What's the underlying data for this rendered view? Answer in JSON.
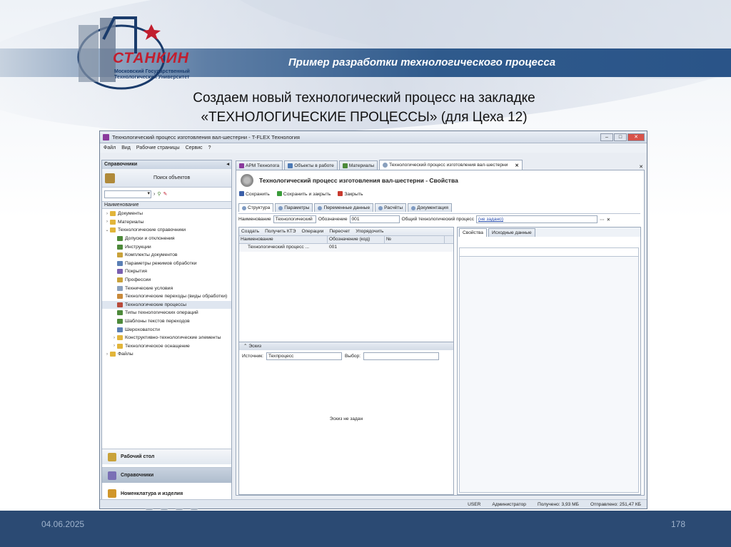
{
  "slide": {
    "title": "Пример разработки технологического процесса",
    "heading_line1": "Создаем новый технологический процесс на закладке",
    "heading_line2": "«ТЕХНОЛОГИЧЕСКИЕ ПРОЦЕССЫ» (для Цеха 12)",
    "date": "04.06.2025",
    "page": "178",
    "logo_name": "СТАНКИН",
    "logo_sub": "Московский Государственный Технологический Университет"
  },
  "window": {
    "title": "Технологический процесс изготовления вал-шестерни - T-FLEX Технология",
    "menu": [
      "Файл",
      "Вид",
      "Рабочие страницы",
      "Сервис",
      "?"
    ]
  },
  "left_panel": {
    "header": "Справочники",
    "search_label": "Поиск объектов",
    "column_header": "Наименование",
    "tree": [
      {
        "label": "Документы",
        "level": 0,
        "arrow": "›",
        "folder": true
      },
      {
        "label": "Материалы",
        "level": 0,
        "arrow": "›",
        "folder": true
      },
      {
        "label": "Технологические справочники",
        "level": 0,
        "arrow": "⌄",
        "folder": true
      },
      {
        "label": "Допуски и отклонения",
        "level": 1,
        "color": "#4d8a3a"
      },
      {
        "label": "Инструкции",
        "level": 1,
        "color": "#4d8a3a"
      },
      {
        "label": "Комплекты документов",
        "level": 1,
        "color": "#c9a23a"
      },
      {
        "label": "Параметры режимов обработки",
        "level": 1,
        "color": "#5a7fb5"
      },
      {
        "label": "Покрытия",
        "level": 1,
        "color": "#7a5fb0"
      },
      {
        "label": "Профессии",
        "level": 1,
        "color": "#c9a23a"
      },
      {
        "label": "Технические условия",
        "level": 1,
        "color": "#8aa0bd"
      },
      {
        "label": "Технологические переходы (виды обработки)",
        "level": 1,
        "color": "#c98a3a"
      },
      {
        "label": "Технологические процессы",
        "level": 1,
        "color": "#b84a3a",
        "selected": true
      },
      {
        "label": "Типы технологических операций",
        "level": 1,
        "color": "#4d8a3a"
      },
      {
        "label": "Шаблоны текстов переходов",
        "level": 1,
        "color": "#4d8a3a"
      },
      {
        "label": "Шероховатости",
        "level": 1,
        "color": "#5a7fb5"
      },
      {
        "label": "Конструктивно-технологические элементы",
        "level": 1,
        "arrow": "›",
        "folder": true
      },
      {
        "label": "Технологическое оснащение",
        "level": 1,
        "arrow": "›",
        "folder": true
      },
      {
        "label": "Файлы",
        "level": 0,
        "arrow": "›",
        "folder": true
      }
    ],
    "nav_buttons": [
      "Рабочий стол",
      "Справочники",
      "Номенклатура и изделия"
    ]
  },
  "tabs": [
    {
      "label": "АРМ Технолога",
      "color": "#8a3a9c"
    },
    {
      "label": "Объекты в работе",
      "color": "#4d7ab5"
    },
    {
      "label": "Материалы",
      "color": "#4d8a3a"
    },
    {
      "label": "Технологический процесс изготовления вал-шестерни",
      "color": "#8aa0bd",
      "active": true
    }
  ],
  "document": {
    "header": "Технологический процесс изготовления вал-шестерни - Свойства",
    "toolbar": [
      "Сохранить",
      "Сохранить и закрыть",
      "Закрыть"
    ],
    "subtabs": [
      "Структура",
      "Параметры",
      "Переменные данные",
      "Расчёты",
      "Документация"
    ],
    "fields": {
      "name_label": "Наименование",
      "name_value": "Технологический",
      "designation_label": "Обозначение",
      "designation_value": "001",
      "common_label": "Общий технологический процесс",
      "common_value": "(не задано)"
    },
    "structure_toolbar": [
      "Создать",
      "Получить КТЭ",
      "Операции",
      "Пересчет",
      "Упорядочить"
    ],
    "grid_columns": [
      "Наименование",
      "Обозначение (код)",
      "№"
    ],
    "grid_rows": [
      {
        "name": "Технологический процесс ...",
        "code": "001",
        "num": ""
      }
    ],
    "sketch": {
      "header": "Эскиз",
      "source_label": "Источник:",
      "source_value": "Техпроцесс",
      "choice_label": "Выбор:",
      "message": "Эскиз не задан"
    },
    "props_tabs": [
      "Свойства",
      "Исходные данные"
    ]
  },
  "status": [
    "USER",
    "Администратор",
    "Получено: 3,93 МБ",
    "Отправлено: 251,47 КБ"
  ]
}
